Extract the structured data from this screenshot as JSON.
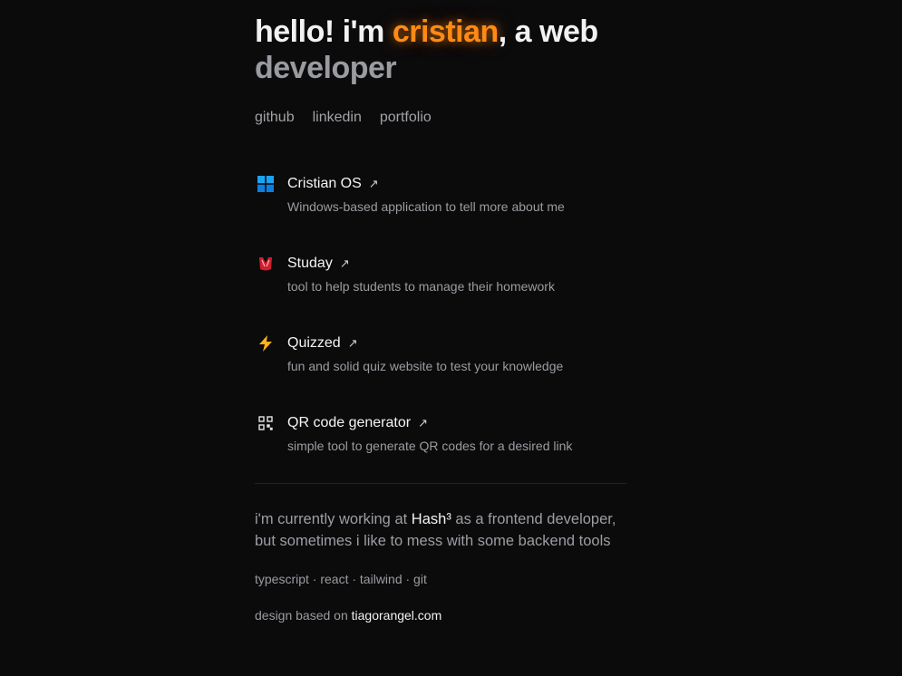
{
  "hero": {
    "greeting": "hello! i'm ",
    "name": "cristian",
    "suffix": ", a web",
    "line2": "developer"
  },
  "links": [
    {
      "label": "github"
    },
    {
      "label": "linkedin"
    },
    {
      "label": "portfolio"
    }
  ],
  "projects": [
    {
      "title": "Cristian OS",
      "description": "Windows-based application to tell more about me",
      "icon": "windows-logo-icon"
    },
    {
      "title": "Studay",
      "description": "tool to help students to manage their homework",
      "icon": "studay-logo-icon"
    },
    {
      "title": "Quizzed",
      "description": "fun and solid quiz website to test your knowledge",
      "icon": "lightning-icon"
    },
    {
      "title": "QR code generator",
      "description": "simple tool to generate QR codes for a desired link",
      "icon": "qr-code-icon"
    }
  ],
  "arrow": "↗",
  "about": {
    "before": "i'm currently working at ",
    "company": "Hash³",
    "after": " as a frontend developer, but sometimes i like to mess with some backend tools"
  },
  "stack": "typescript · react · tailwind · git",
  "credit": {
    "text": "design based on ",
    "link": "tiagorangel.com"
  },
  "colors": {
    "accent": "#ff8a14",
    "background": "#0b0b0c"
  }
}
